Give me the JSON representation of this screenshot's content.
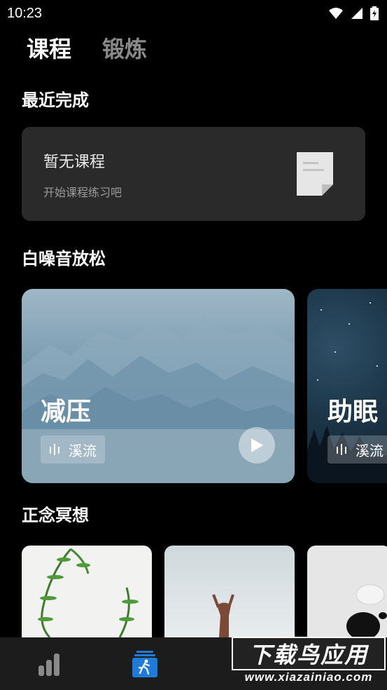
{
  "status_bar": {
    "time": "10:23"
  },
  "tabs": [
    {
      "label": "课程",
      "active": true
    },
    {
      "label": "锻炼",
      "active": false
    }
  ],
  "recent": {
    "section_title": "最近完成",
    "empty_title": "暂无课程",
    "empty_subtitle": "开始课程练习吧"
  },
  "white_noise": {
    "section_title": "白噪音放松",
    "cards": [
      {
        "label": "减压",
        "sound": "溪流"
      },
      {
        "label": "助眠",
        "sound": "溪流"
      }
    ]
  },
  "meditation": {
    "section_title": "正念冥想"
  },
  "watermark": {
    "text": "下载鸟应用",
    "url": "www.xiazainiao.com"
  },
  "colors": {
    "background": "#000000",
    "card": "#2a2a2a",
    "inactive_tab": "#8a8a8a",
    "accent_blue": "#1e7bd8"
  }
}
